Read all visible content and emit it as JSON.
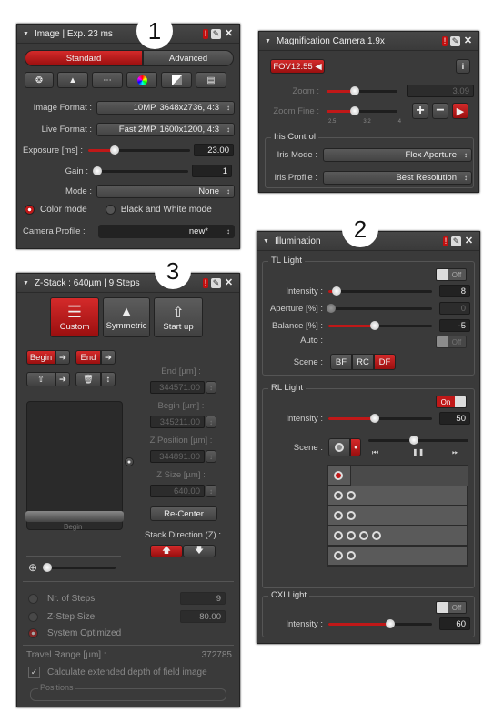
{
  "callouts": [
    "1",
    "2",
    "3"
  ],
  "image_panel": {
    "title": "Image | Exp. 23 ms",
    "tab_standard": "Standard",
    "tab_advanced": "Advanced",
    "image_format_label": "Image Format :",
    "image_format_value": "10MP, 3648x2736, 4:3",
    "live_format_label": "Live Format :",
    "live_format_value": "Fast 2MP, 1600x1200, 4:3",
    "exposure_label": "Exposure [ms] :",
    "exposure_value": "23.00",
    "gain_label": "Gain :",
    "gain_value": "1",
    "mode_label": "Mode :",
    "mode_value": "None",
    "color_mode_label": "Color mode",
    "bw_mode_label": "Black and White mode",
    "camera_profile_label": "Camera Profile :",
    "camera_profile_value": "new*"
  },
  "magnification_panel": {
    "title": "Magnification  Camera 1.9x",
    "fov_label": "FOV12.55",
    "zoom_label": "Zoom :",
    "zoom_value": "3.09",
    "zoom_fine_label": "Zoom Fine :",
    "zoom_fine_ticks": [
      "2.5",
      "3.2",
      "4"
    ],
    "plus": "+",
    "minus": "−",
    "iris_title": "Iris Control",
    "iris_mode_label": "Iris Mode :",
    "iris_mode_value": "Flex Aperture",
    "iris_profile_label": "Iris Profile :",
    "iris_profile_value": "Best Resolution"
  },
  "illumination_panel": {
    "title": "Illumination",
    "tl_title": "TL Light",
    "tl_toggle": "Off",
    "intensity_label": "Intensity :",
    "tl_intensity_value": "8",
    "aperture_label": "Aperture [%] :",
    "aperture_value": "0",
    "balance_label": "Balance [%] :",
    "balance_value": "-5",
    "auto_label": "Auto :",
    "auto_toggle": "Off",
    "scene_label": "Scene :",
    "scene_bf": "BF",
    "scene_rc": "RC",
    "scene_df": "DF",
    "rl_title": "RL Light",
    "rl_toggle": "On",
    "rl_intensity_value": "50",
    "cxi_title": "CXI Light",
    "cxi_toggle": "Off",
    "cxi_intensity_value": "60",
    "rl_level": 0.45,
    "cxi_level": 0.6
  },
  "zstack_panel": {
    "title": "Z-Stack : 640µm | 9 Steps",
    "custom_label": "Custom",
    "symmetric_label": "Symmetric",
    "startup_label": "Start up",
    "begin_btn": "Begin",
    "end_btn": "End",
    "end_label": "End  [µm] :",
    "end_value": "344571.00",
    "begin_label": "Begin  [µm] :",
    "begin_value": "345211.00",
    "zpos_label": "Z Position [µm] :",
    "zpos_value": "344891.00",
    "zsize_label": "Z Size [µm] :",
    "zsize_value": "640.00",
    "recenter_label": "Re-Center",
    "stack_direction_label": "Stack Direction (Z) :",
    "stage_begin_label": "Begin",
    "nr_steps_label": "Nr. of Steps",
    "nr_steps_value": "9",
    "zstep_label": "Z-Step Size",
    "zstep_value": "80.00",
    "system_opt_label": "System Optimized",
    "travel_label": "Travel Range [µm] :",
    "travel_value": "372785",
    "edof_label": "Calculate extended depth of field image",
    "positions_label": "Positions"
  }
}
